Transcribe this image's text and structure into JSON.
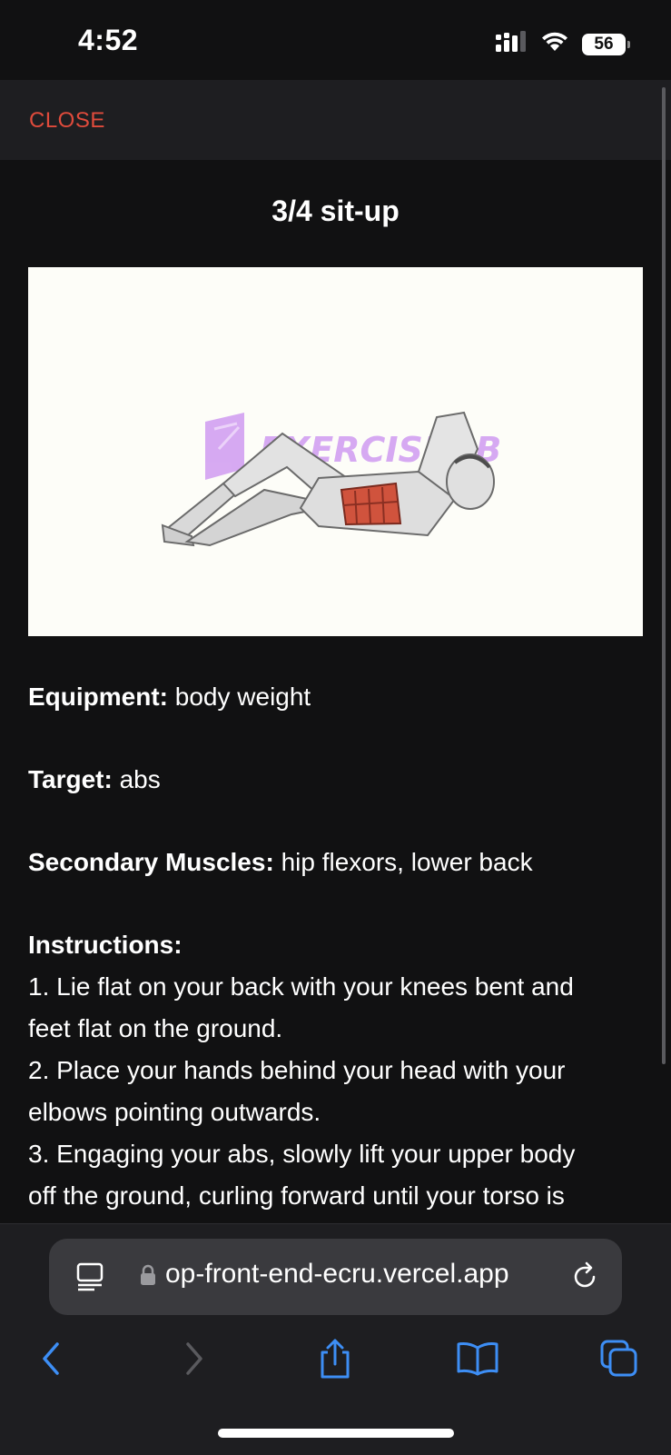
{
  "status_bar": {
    "time": "4:52",
    "battery": "56"
  },
  "header": {
    "close_label": "CLOSE"
  },
  "exercise": {
    "title": "3/4 sit-up",
    "image_watermark": "EXERCISEDB",
    "equipment_label": "Equipment:",
    "equipment_value": "body weight",
    "target_label": "Target:",
    "target_value": "abs",
    "secondary_label": "Secondary Muscles:",
    "secondary_value": "hip flexors, lower back",
    "instructions_label": "Instructions:",
    "instruction_lines": [
      "1. Lie flat on your back with your knees bent and",
      "feet flat on the ground.",
      "2. Place your hands behind your head with your",
      "elbows pointing outwards.",
      "3. Engaging your abs, slowly lift your upper body",
      "off the ground, curling forward until your torso is"
    ]
  },
  "browser": {
    "url": "op-front-end-ecru.vercel.app"
  },
  "colors": {
    "accent_close": "#e04b3c",
    "link_blue": "#3d8ef5",
    "background": "#111112",
    "bar_background": "#1e1e21"
  },
  "icons": {
    "status": [
      "cellular-signal-icon",
      "wifi-icon",
      "battery-icon"
    ],
    "url_bar": [
      "page-menu-icon",
      "lock-icon",
      "reload-icon"
    ],
    "toolbar": [
      "back-chevron-icon",
      "forward-chevron-icon",
      "share-icon",
      "bookmarks-icon",
      "tabs-icon"
    ]
  }
}
